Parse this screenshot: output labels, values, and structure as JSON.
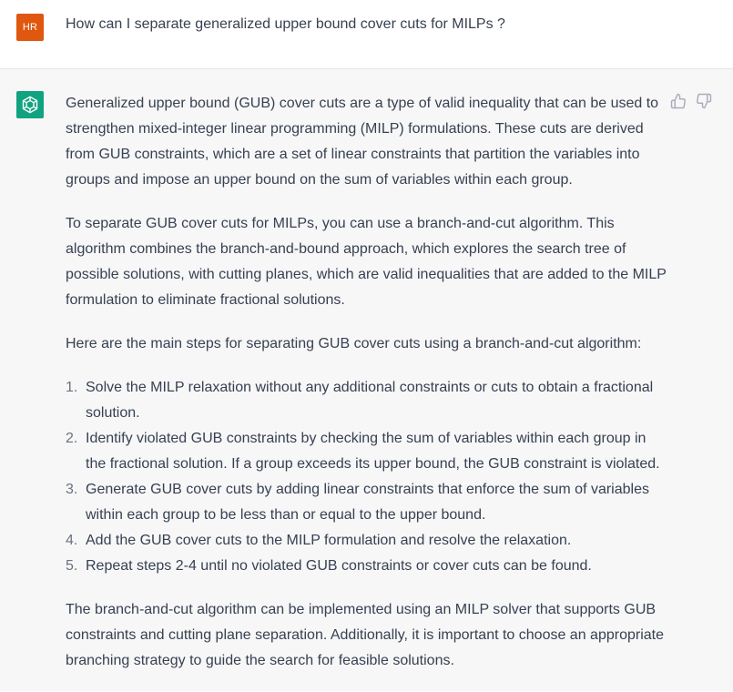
{
  "user": {
    "initials": "HR",
    "message": "How can I separate generalized upper bound cover cuts for MILPs ?"
  },
  "assistant": {
    "avatar_icon": "openai-logo-icon",
    "intro": "Generalized upper bound (GUB) cover cuts are a type of valid inequality that can be used to strengthen mixed-integer linear programming (MILP) formulations. These cuts are derived from GUB constraints, which are a set of linear constraints that partition the variables into groups and impose an upper bound on the sum of variables within each group.",
    "method": "To separate GUB cover cuts for MILPs, you can use a branch-and-cut algorithm. This algorithm combines the branch-and-bound approach, which explores the search tree of possible solutions, with cutting planes, which are valid inequalities that are added to the MILP formulation to eliminate fractional solutions.",
    "steps_intro": "Here are the main steps for separating GUB cover cuts using a branch-and-cut algorithm:",
    "steps": [
      {
        "num": "1.",
        "text": "Solve the MILP relaxation without any additional constraints or cuts to obtain a fractional solution."
      },
      {
        "num": "2.",
        "text": "Identify violated GUB constraints by checking the sum of variables within each group in the fractional solution. If a group exceeds its upper bound, the GUB constraint is violated."
      },
      {
        "num": "3.",
        "text": "Generate GUB cover cuts by adding linear constraints that enforce the sum of variables within each group to be less than or equal to the upper bound."
      },
      {
        "num": "4.",
        "text": "Add the GUB cover cuts to the MILP formulation and resolve the relaxation."
      },
      {
        "num": "5.",
        "text": "Repeat steps 2-4 until no violated GUB constraints or cover cuts can be found."
      }
    ],
    "conclusion": "The branch-and-cut algorithm can be implemented using an MILP solver that supports GUB constraints and cutting plane separation. Additionally, it is important to choose an appropriate branching strategy to guide the search for feasible solutions."
  },
  "colors": {
    "user_avatar": "#e0570f",
    "assistant_avatar": "#10a37f",
    "assistant_bg": "#f7f7f8"
  }
}
